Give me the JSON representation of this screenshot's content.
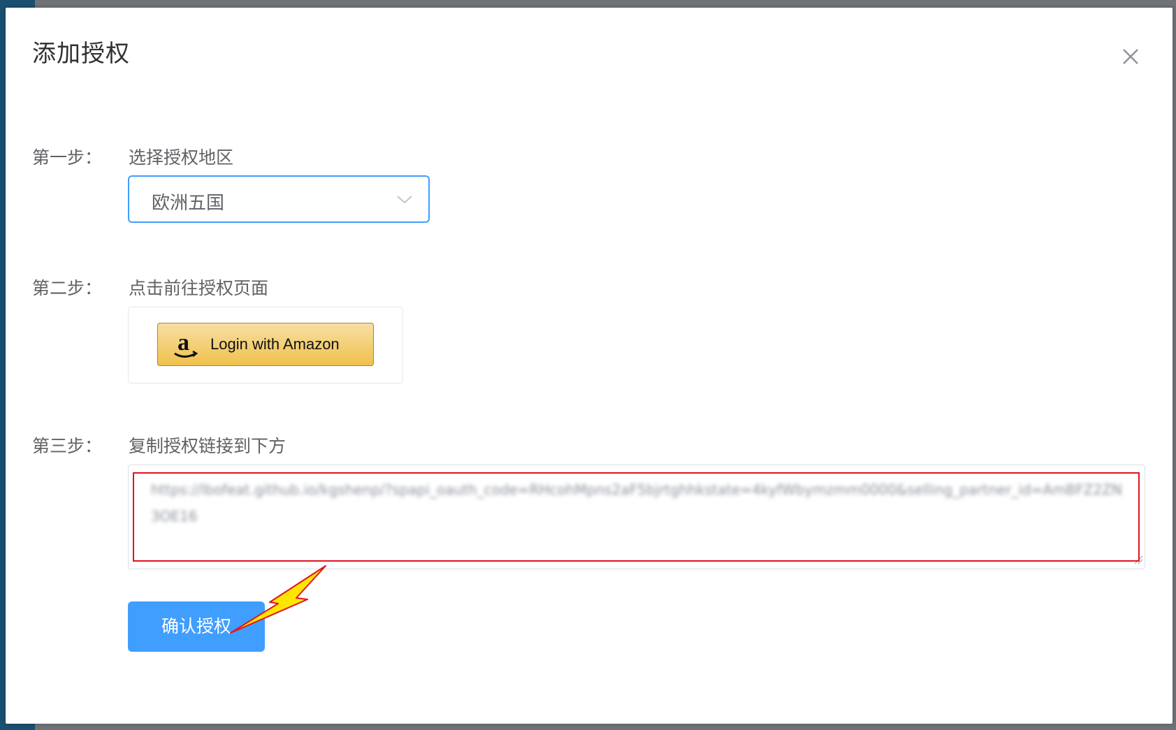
{
  "dialog": {
    "title": "添加授权",
    "close_icon": "close-icon"
  },
  "steps": [
    {
      "label": "第一步：",
      "text": "选择授权地区"
    },
    {
      "label": "第二步：",
      "text": "点击前往授权页面"
    },
    {
      "label": "第三步：",
      "text": "复制授权链接到下方"
    }
  ],
  "region_select": {
    "value": "欧洲五国",
    "icon": "chevron-down-icon",
    "border_color": "#409eff"
  },
  "amazon_button": {
    "label": "Login with Amazon",
    "icon": "amazon-logo-icon"
  },
  "auth_url": {
    "value": "https://lbofeat.github.io/kgshenp/?spapi_oauth_code=RHcohMpns2aF5bjrtghhkstate=4kyfWbymzmm0000&selling_partner_id=AmBFZ2ZN3OE16",
    "highlight_color": "#e0141e"
  },
  "confirm_button": {
    "label": "确认授权",
    "color": "#409eff"
  },
  "annotation": {
    "arrow_color": "#ffe600",
    "arrow_outline": "#e0141e"
  }
}
